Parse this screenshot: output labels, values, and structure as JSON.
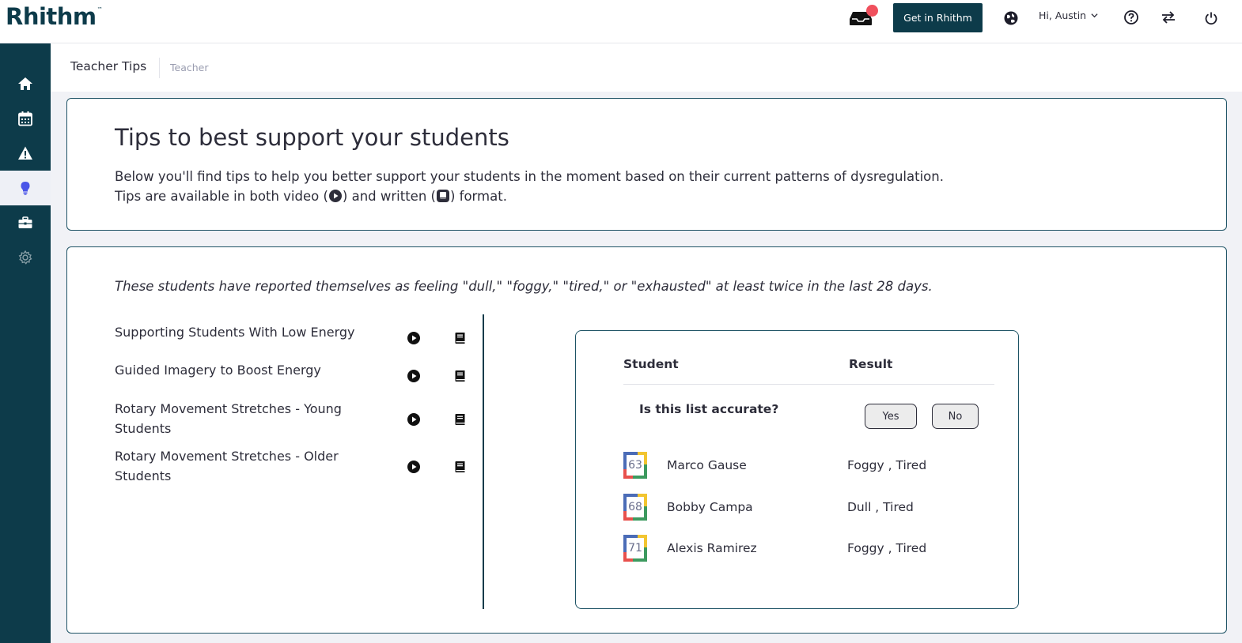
{
  "app": {
    "logo": "Rhithm",
    "logo_mark": "™"
  },
  "topbar": {
    "cta_label": "Get in Rhithm",
    "greeting": "Hi, Austin",
    "colors": {
      "brand": "#0d3b4a",
      "notification": "#f0505d"
    }
  },
  "sidebar": {
    "items": [
      {
        "icon": "home-icon"
      },
      {
        "icon": "calendar-icon"
      },
      {
        "icon": "alert-icon"
      },
      {
        "icon": "lightbulb-icon",
        "active": true
      },
      {
        "icon": "toolbox-icon"
      },
      {
        "icon": "gear-icon"
      }
    ]
  },
  "breadcrumb": {
    "title": "Teacher Tips",
    "sub": "Teacher"
  },
  "intro": {
    "heading": "Tips to best support your students",
    "line1": "Below you'll find tips to help you better support your students in the moment based on their current patterns of dysregulation.",
    "line2_a": "Tips are available in both video (",
    "line2_b": ") and written (",
    "line2_c": ") format."
  },
  "section": {
    "notice": "These students have reported themselves as feeling \"dull,\" \"foggy,\" \"tired,\" or \"exhausted\" at least twice in the last 28 days.",
    "tips": [
      {
        "title": "Supporting Students With Low Energy"
      },
      {
        "title": "Guided Imagery to Boost Energy"
      },
      {
        "title": "Rotary Movement Stretches - Young Students"
      },
      {
        "title": "Rotary Movement Stretches - Older Students"
      }
    ]
  },
  "students": {
    "col_student": "Student",
    "col_result": "Result",
    "question": "Is this list accurate?",
    "yes_label": "Yes",
    "no_label": "No",
    "rows": [
      {
        "score": "63",
        "name": "Marco Gause",
        "result": "Foggy , Tired"
      },
      {
        "score": "68",
        "name": "Bobby Campa",
        "result": "Dull , Tired"
      },
      {
        "score": "71",
        "name": "Alexis Ramirez",
        "result": "Foggy , Tired"
      }
    ]
  }
}
